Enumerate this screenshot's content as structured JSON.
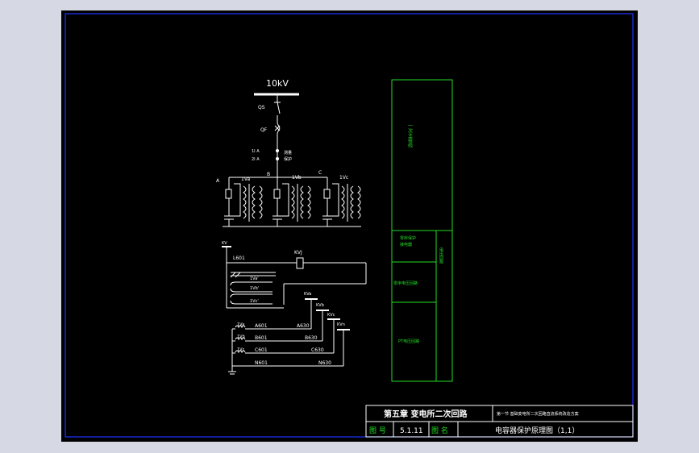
{
  "colors": {
    "background": "#000000",
    "line": "#ffffff",
    "frame": "#2233ff",
    "table": "#22dd22",
    "surround": "#d6d9e3"
  },
  "schematic": {
    "bus_label": "10kV",
    "qs_label": "QS",
    "qf_label": "QF",
    "ct_labels": [
      "1I A",
      "2I A"
    ],
    "ct_side_label": "测量\n保护",
    "phase_a": "A",
    "phase_b": "B",
    "phase_c": "C",
    "pt_a": "1Va",
    "pt_b": "1Vb",
    "pt_c": "1Vc",
    "kv_top": "KV",
    "l601": "L601",
    "kvj": "KVJ",
    "open_delta": [
      "1Va'",
      "1Vb'",
      "1Vc'"
    ],
    "sec_a": "1Va",
    "sec_b": "1Vb",
    "sec_c": "1Vc",
    "a601": "A601",
    "b601": "B601",
    "c601": "C601",
    "n601": "N601",
    "a630": "A630",
    "b630": "B630",
    "c630": "C630",
    "n630": "N630",
    "kva": "KVa",
    "kvb": "KVb",
    "kvc": "KVc",
    "kvn": "KVn"
  },
  "side_table": {
    "top": "一次主接线",
    "row1": "零序保护\n接电器",
    "row2": "零序电压回路",
    "row3": "PT电压回路",
    "right": "电压回路"
  },
  "title_block": {
    "chapter": "第五章  变电所二次回路",
    "section": "第一节  基础变电所二次回路直流系统改造方案",
    "fig_no_label": "图  号",
    "fig_no": "5.1.11",
    "fig_name_label": "图  名",
    "fig_name": "电容器保护原理图（1,1）"
  }
}
